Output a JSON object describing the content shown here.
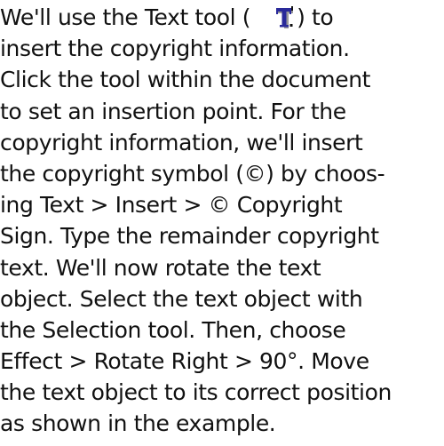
{
  "paragraph": {
    "line1_before": "We'll use the Text tool (",
    "line1_after": ") to",
    "lines": [
      "insert the copyright information.",
      "Click the tool within the document",
      "to set an insertion point. For the",
      "copyright information, we'll insert",
      "the copyright symbol (©) by choos-",
      "ing Text > Insert > © Copyright",
      "Sign. Type the remainder copyright",
      "text. We'll now rotate the text",
      "object. Select the text object with",
      "the Selection tool. Then, choose",
      "Effect > Rotate Right > 90°. Move",
      "the text object to its correct position",
      "as shown in the example."
    ]
  },
  "icons": {
    "text_tool": "text-tool-icon"
  },
  "colors": {
    "text": "#111111",
    "icon_fill": "#2a2a9a",
    "icon_shadow": "#8a8a8a"
  }
}
